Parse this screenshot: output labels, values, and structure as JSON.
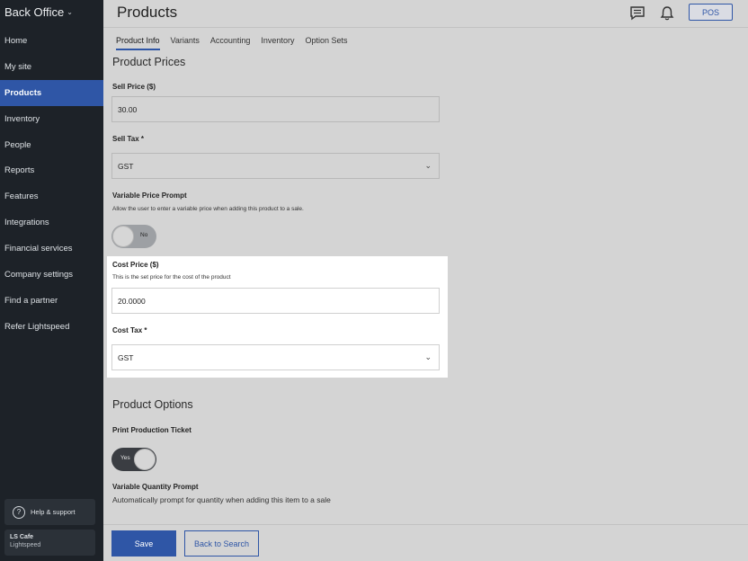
{
  "sidebar": {
    "brand": "Back Office",
    "items": [
      {
        "label": "Home"
      },
      {
        "label": "My site"
      },
      {
        "label": "Products"
      },
      {
        "label": "Inventory"
      },
      {
        "label": "People"
      },
      {
        "label": "Reports"
      },
      {
        "label": "Features"
      },
      {
        "label": "Integrations"
      },
      {
        "label": "Financial services"
      },
      {
        "label": "Company settings"
      },
      {
        "label": "Find a partner"
      },
      {
        "label": "Refer Lightspeed"
      }
    ],
    "help_label": "Help & support",
    "account_name": "LS Cafe",
    "account_sub": "Lightspeed"
  },
  "header": {
    "title": "Products",
    "pos_label": "POS"
  },
  "tabs": [
    {
      "label": "Product Info"
    },
    {
      "label": "Variants"
    },
    {
      "label": "Accounting"
    },
    {
      "label": "Inventory"
    },
    {
      "label": "Option Sets"
    }
  ],
  "prices": {
    "section_title": "Product Prices",
    "sell_price_label": "Sell Price ($)",
    "sell_price_value": "30.00",
    "sell_tax_label": "Sell Tax *",
    "sell_tax_value": "GST",
    "variable_price_label": "Variable Price Prompt",
    "variable_price_help": "Allow the user to enter a variable price when adding this product to a sale.",
    "variable_price_toggle": "No",
    "cost_price_label": "Cost Price ($)",
    "cost_price_help": "This is the set price for the cost of the product",
    "cost_price_value": "20.0000",
    "cost_tax_label": "Cost Tax *",
    "cost_tax_value": "GST"
  },
  "options": {
    "section_title": "Product Options",
    "print_ticket_label": "Print Production Ticket",
    "print_ticket_toggle": "Yes",
    "variable_qty_label": "Variable Quantity Prompt",
    "variable_qty_help": "Automatically prompt for quantity when adding this item to a sale"
  },
  "footer": {
    "save_label": "Save",
    "back_label": "Back to Search"
  }
}
